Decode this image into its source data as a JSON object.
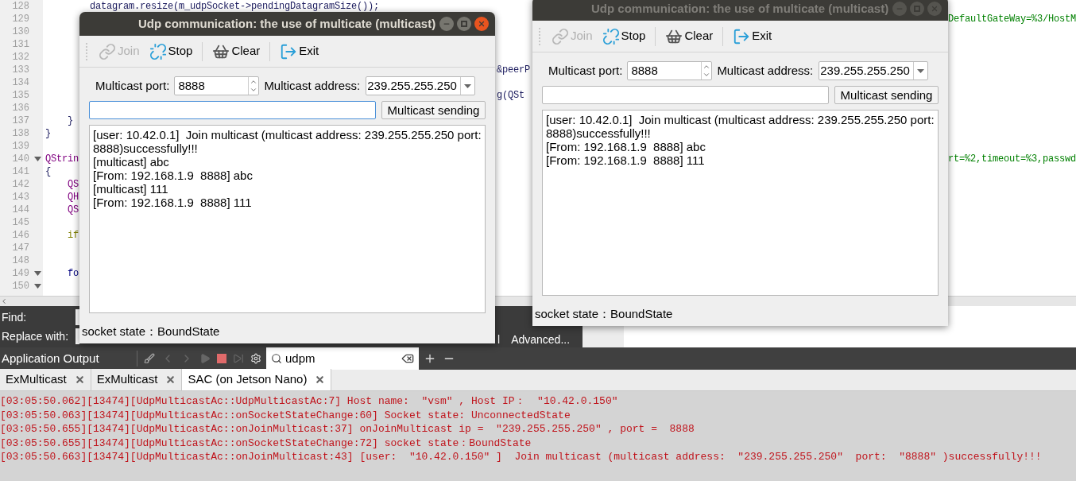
{
  "editor": {
    "lines": [
      {
        "number": "128",
        "foldable": false,
        "left": {
          "kind": "plain",
          "text": "        datagram.resize(m_udpSocket->pendingDatagramSize());"
        }
      },
      {
        "number": "129",
        "foldable": false,
        "right": {
          "kind": "string",
          "text": "DefaultGateWay=%3/HostM"
        }
      },
      {
        "number": "130",
        "foldable": false
      },
      {
        "number": "131",
        "foldable": false
      },
      {
        "number": "132",
        "foldable": false
      },
      {
        "number": "133",
        "foldable": false,
        "middle": {
          "kind": "plain",
          "text": "&peerP"
        }
      },
      {
        "number": "134",
        "foldable": false
      },
      {
        "number": "135",
        "foldable": false,
        "middle": {
          "kind": "plain",
          "text": "g(QSt"
        }
      },
      {
        "number": "136",
        "foldable": false
      },
      {
        "number": "137",
        "foldable": false,
        "left": {
          "kind": "plain",
          "text": "    }"
        }
      },
      {
        "number": "138",
        "foldable": false,
        "left": {
          "kind": "plain",
          "text": "}"
        }
      },
      {
        "number": "139",
        "foldable": false
      },
      {
        "number": "140",
        "foldable": true,
        "left": {
          "kind": "type",
          "text": "QStrin"
        },
        "right": {
          "kind": "string",
          "text": "rt=%2,timeout=%3,passwd"
        }
      },
      {
        "number": "141",
        "foldable": false,
        "left": {
          "kind": "plain",
          "text": "{"
        }
      },
      {
        "number": "142",
        "foldable": false,
        "left": {
          "kind": "type",
          "text": "    QS"
        }
      },
      {
        "number": "143",
        "foldable": false,
        "left": {
          "kind": "type",
          "text": "    QH"
        }
      },
      {
        "number": "144",
        "foldable": false,
        "left": {
          "kind": "type",
          "text": "    QS"
        }
      },
      {
        "number": "145",
        "foldable": false
      },
      {
        "number": "146",
        "foldable": false,
        "left": {
          "kind": "keyword",
          "text": "    if"
        }
      },
      {
        "number": "147",
        "foldable": false
      },
      {
        "number": "148",
        "foldable": false
      },
      {
        "number": "149",
        "foldable": true,
        "left": {
          "kind": "control",
          "text": "    fo"
        }
      },
      {
        "number": "150",
        "foldable": true
      }
    ]
  },
  "find_bar": {
    "find_label": "Find:",
    "replace_label": "Replace with:",
    "buttons": [
      "l",
      "Advanced..."
    ]
  },
  "output": {
    "title": "Application Output",
    "search": "udpm",
    "tabs": [
      {
        "label": "ExMulticast",
        "selected": false
      },
      {
        "label": "ExMulticast",
        "selected": false
      },
      {
        "label": "SAC (on Jetson Nano)",
        "selected": true
      }
    ],
    "lines": [
      "[03:05:50.062][13474][UdpMulticastAc::UdpMulticastAc:7] Host name:  \"vsm\" , Host IP：  \"10.42.0.150\"",
      "[03:05:50.063][13474][UdpMulticastAc::onSocketStateChange:60] Socket state: UnconnectedState",
      "[03:05:50.655][13474][UdpMulticastAc::onJoinMulticast:37] onJoinMulticast ip =  \"239.255.255.250\" , port =  8888",
      "[03:05:50.655][13474][UdpMulticastAc::onSocketStateChange:72] socket state：BoundState",
      "[03:05:50.663][13474][UdpMulticastAc::onJoinMulticast:43] [user:  \"10.42.0.150\" ]  Join multicast (multicast address:  \"239.255.255.250\"  port:  \"8888\" )successfully!!!"
    ]
  },
  "windows": [
    {
      "title": "Udp communication: the use of multicate (multicast)",
      "active": true,
      "toolbar": [
        {
          "kind": "join",
          "label": "Join",
          "disabled": true
        },
        {
          "kind": "stop",
          "label": "Stop",
          "disabled": false
        },
        {
          "kind": "clear",
          "label": "Clear",
          "disabled": false
        },
        {
          "kind": "exit",
          "label": "Exit",
          "disabled": false
        }
      ],
      "port_label": "Multicast port:",
      "port": "8888",
      "address_label": "Multicast address:",
      "address": "239.255.255.250",
      "message_focused": true,
      "send_button": "Multicast sending",
      "log": [
        "[user: 10.42.0.1]  Join multicast (multicast address: 239.255.255.250 port: 8888)successfully!!!",
        "[multicast] abc",
        "[From: 192.168.1.9  8888] abc",
        "[multicast] 111",
        "[From: 192.168.1.9  8888] 111"
      ],
      "status": "socket state：BoundState"
    },
    {
      "title": "Udp communication: the use of multicate (multicast)",
      "active": false,
      "toolbar": [
        {
          "kind": "join",
          "label": "Join",
          "disabled": true
        },
        {
          "kind": "stop",
          "label": "Stop",
          "disabled": false
        },
        {
          "kind": "clear",
          "label": "Clear",
          "disabled": false
        },
        {
          "kind": "exit",
          "label": "Exit",
          "disabled": false
        }
      ],
      "port_label": "Multicast port:",
      "port": "8888",
      "address_label": "Multicast address:",
      "address": "239.255.255.250",
      "message_focused": false,
      "send_button": "Multicast sending",
      "log": [
        "[user: 10.42.0.1]  Join multicast (multicast address: 239.255.255.250 port: 8888)successfully!!!",
        "[From: 192.168.1.9  8888] abc",
        "[From: 192.168.1.9  8888] 111"
      ],
      "status": "socket state：BoundState"
    }
  ]
}
